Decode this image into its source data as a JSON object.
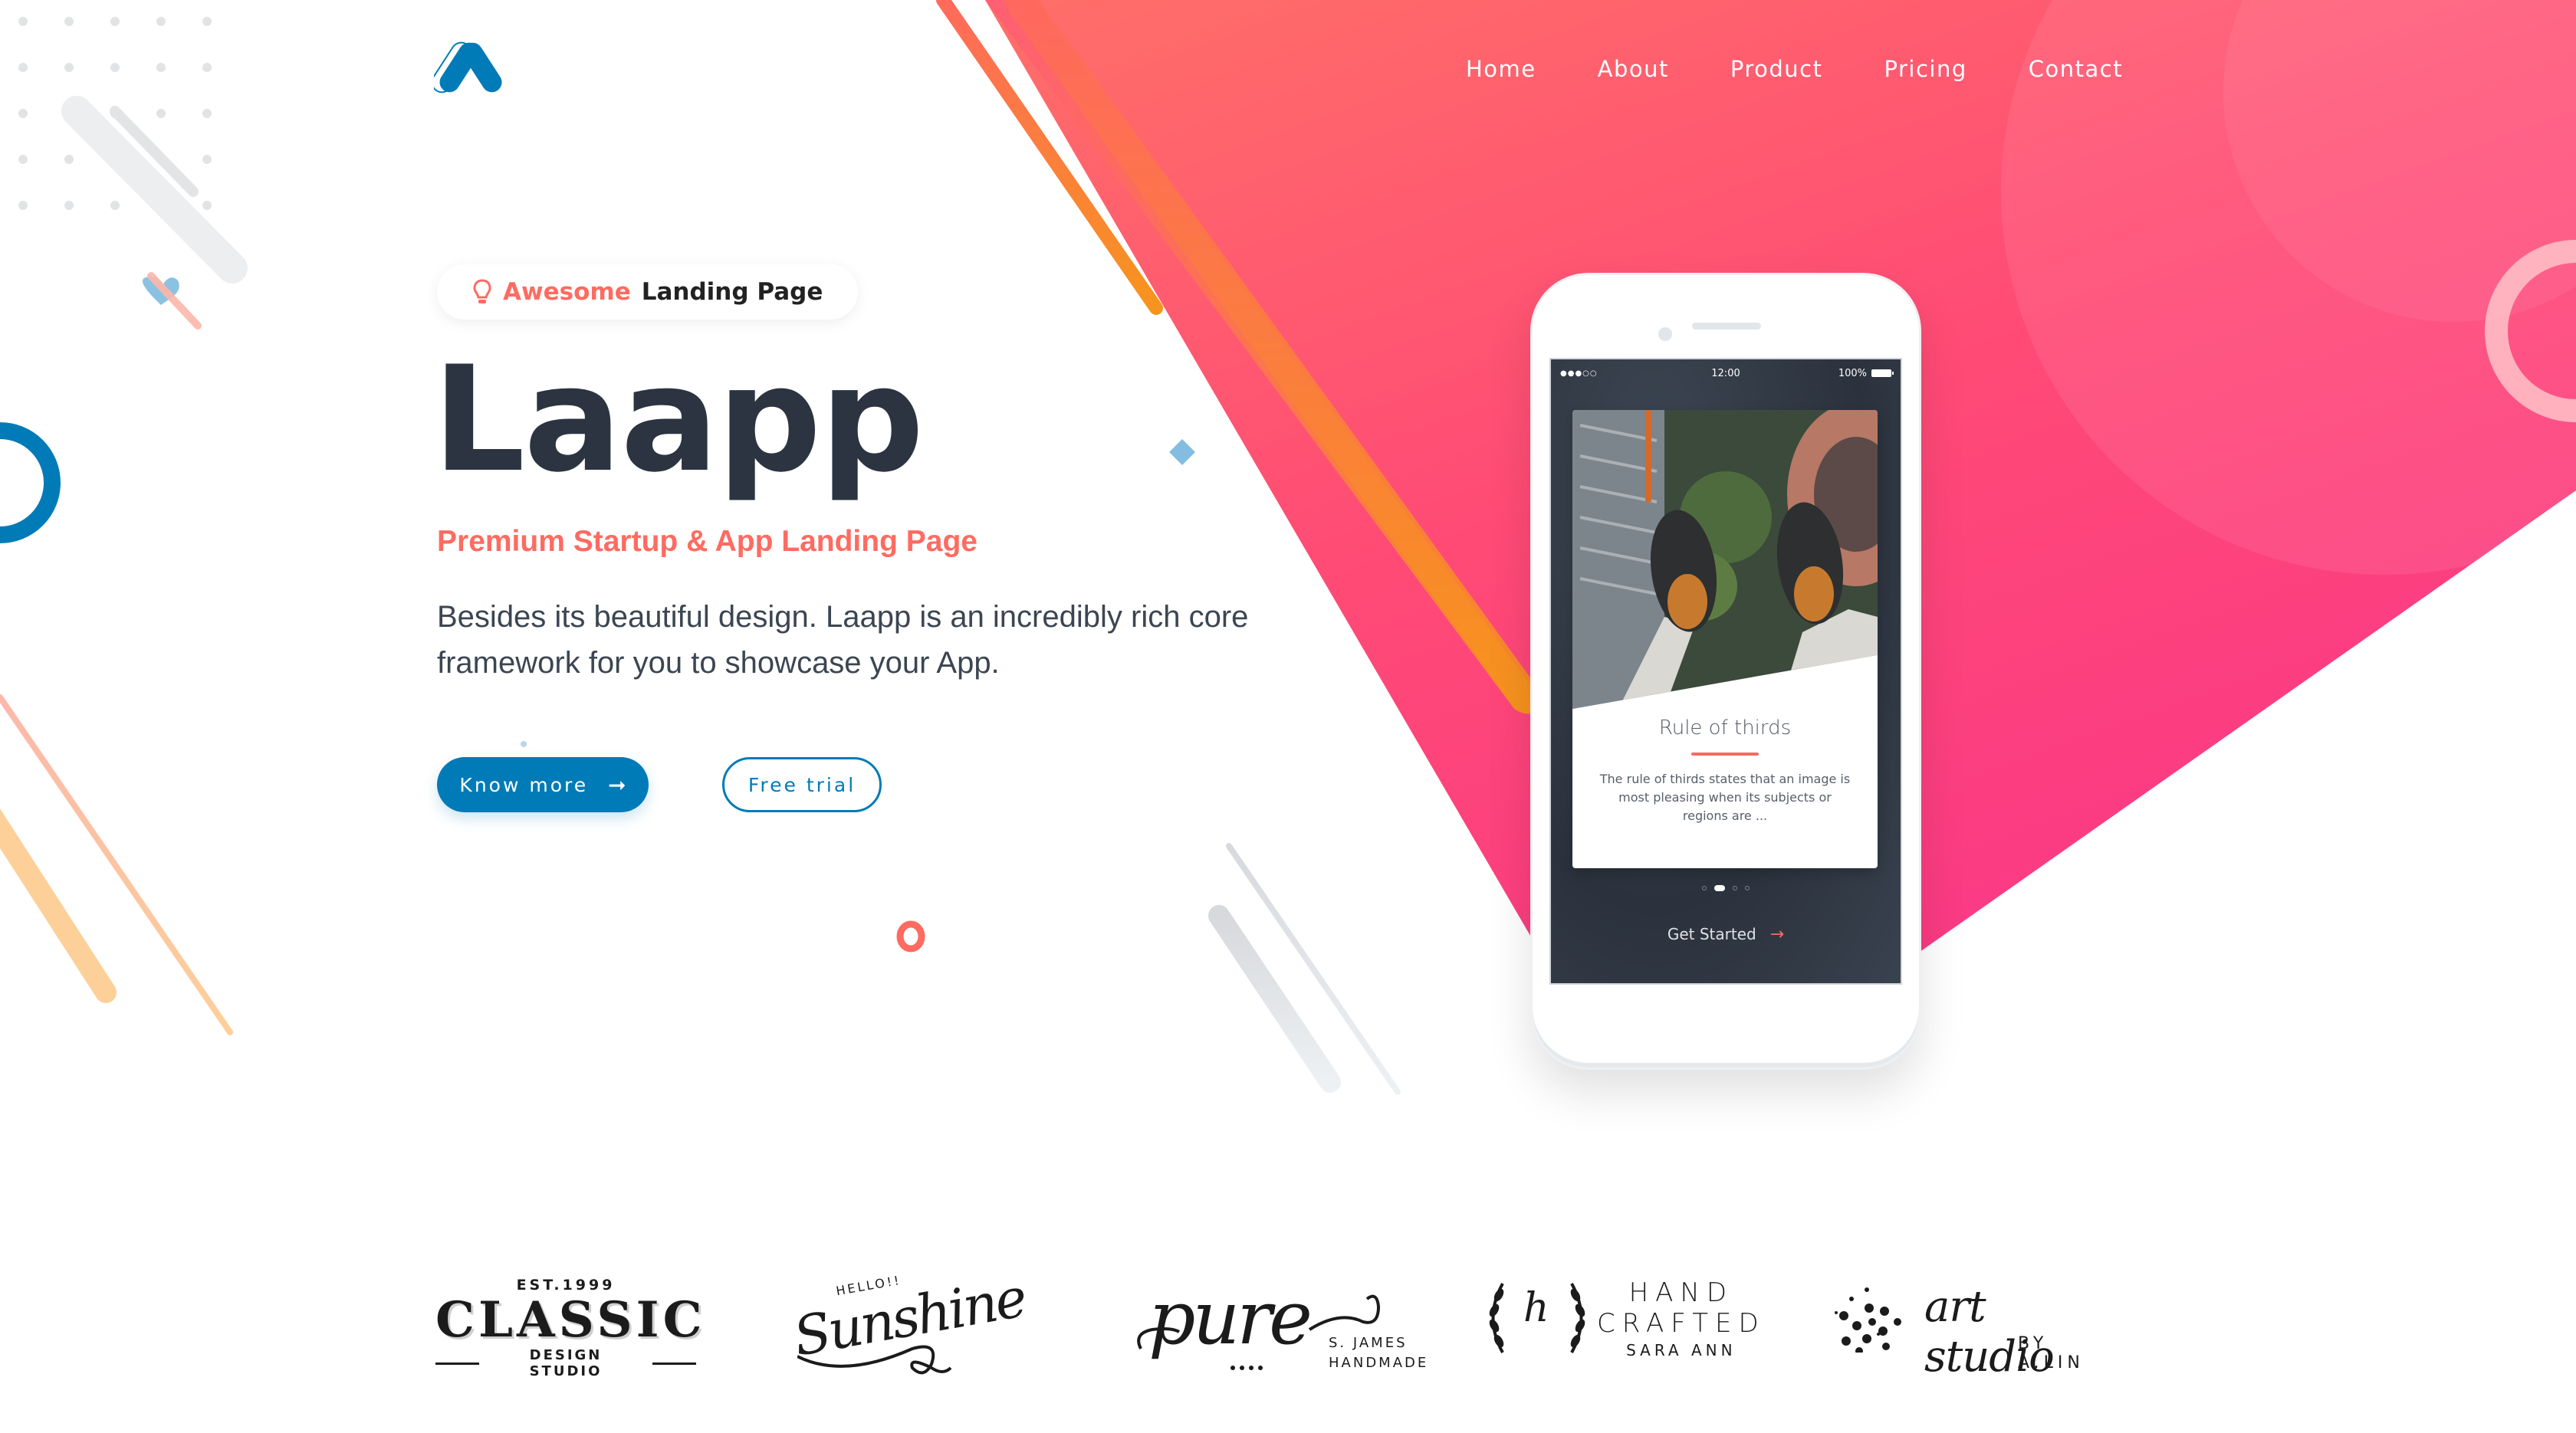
{
  "brand": {
    "logo_icon": "laapp-chevron-logo",
    "primary_color": "#017bb8",
    "accent_color": "#ff6b61",
    "hero_gradient": [
      "#ff6b6b",
      "#ff3d7f",
      "#f7941d"
    ]
  },
  "nav": {
    "items": [
      {
        "label": "Home"
      },
      {
        "label": "About"
      },
      {
        "label": "Product"
      },
      {
        "label": "Pricing"
      },
      {
        "label": "Contact"
      }
    ]
  },
  "hero": {
    "badge": {
      "icon": "lightbulb-icon",
      "highlight": "Awesome",
      "text": "Landing Page"
    },
    "title": "Laapp",
    "subtitle": "Premium Startup & App Landing Page",
    "description": "Besides its beautiful design. Laapp is an incredibly rich core framework for you to showcase your App.",
    "primary_button": {
      "label": "Know more",
      "icon": "arrow-right-icon",
      "icon_glyph": "➞"
    },
    "secondary_button": {
      "label": "Free trial"
    }
  },
  "phone": {
    "status_bar": {
      "signal": "●●●○○",
      "time": "12:00",
      "battery": "100%"
    },
    "card": {
      "title": "Rule of thirds",
      "text": "The rule of thirds states that an image is most pleasing when its subjects or regions are ..."
    },
    "pagination": {
      "total": 4,
      "active": 2
    },
    "cta": {
      "label": "Get Started",
      "icon_glyph": "→"
    }
  },
  "client_logos": [
    {
      "name": "classic",
      "top": "EST.1999",
      "main": "CLASSIC",
      "sub": "DESIGN STUDIO"
    },
    {
      "name": "sunshine",
      "top": "HELLO!!",
      "main": "Sunshine"
    },
    {
      "name": "pure",
      "main": "pure",
      "sub1": "S. JAMES",
      "sub2": "HANDMADE"
    },
    {
      "name": "hand-crafted",
      "mark": "h",
      "line1": "HAND",
      "line2": "CRAFTED",
      "line3": "SARA ANN"
    },
    {
      "name": "art-studio",
      "main": "art studio",
      "sub": "BY A.LIN"
    }
  ]
}
